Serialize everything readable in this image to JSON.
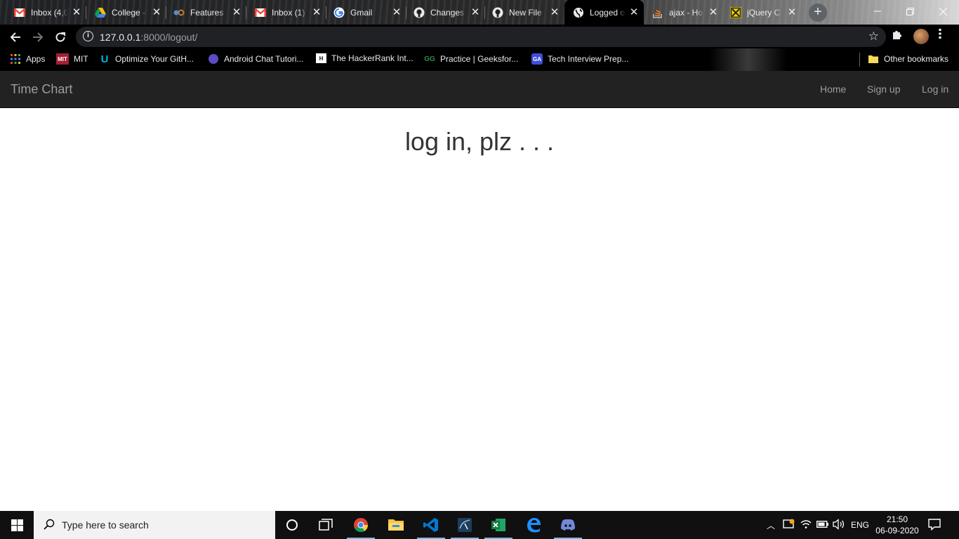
{
  "browser": {
    "tabs": [
      {
        "title": "Inbox (4,0",
        "icon": "gmail-icon",
        "color": "#ea4335"
      },
      {
        "title": "College -",
        "icon": "google-drive-icon",
        "color": "#fbbc04"
      },
      {
        "title": "Features",
        "icon": "feature-site-icon",
        "color": "#4a90d9"
      },
      {
        "title": "Inbox (1)",
        "icon": "gmail-icon",
        "color": "#ea4335"
      },
      {
        "title": "Gmail",
        "icon": "google-icon",
        "color": "#4285f4"
      },
      {
        "title": "Changes",
        "icon": "github-icon",
        "color": "#ffffff"
      },
      {
        "title": "New File",
        "icon": "github-icon",
        "color": "#ffffff"
      },
      {
        "title": "Logged o",
        "icon": "globe-icon",
        "color": "#ffffff",
        "active": true
      },
      {
        "title": "ajax - Ho",
        "icon": "stackoverflow-icon",
        "color": "#f48024"
      },
      {
        "title": "jQuery C",
        "icon": "jquery-icon",
        "color": "#f5d000"
      }
    ],
    "url_host": "127.0.0.1",
    "url_path": ":8000/logout/",
    "bookmarks": [
      {
        "label": "Apps",
        "icon": "apps-grid-icon"
      },
      {
        "label": "MIT",
        "icon": "mit-ocw-icon"
      },
      {
        "label": "Optimize Your GitH...",
        "icon": "udacity-icon"
      },
      {
        "label": "Android Chat Tutori...",
        "icon": "purple-circle-icon"
      },
      {
        "label": "The HackerRank Int...",
        "icon": "hackerrank-icon"
      },
      {
        "label": "Practice | Geeksfor...",
        "icon": "geeksforgeeks-icon"
      },
      {
        "label": "Tech Interview Prep...",
        "icon": "ga-icon"
      }
    ],
    "other_bookmarks": "Other bookmarks"
  },
  "page": {
    "brand": "Time Chart",
    "nav": {
      "home": "Home",
      "signup": "Sign up",
      "login": "Log in"
    },
    "heading": "log in, plz . . ."
  },
  "taskbar": {
    "search_placeholder": "Type here to search",
    "apps": [
      "cortana-icon",
      "task-view-icon",
      "chrome-icon",
      "file-explorer-icon",
      "vscode-icon",
      "mysql-workbench-icon",
      "excel-icon",
      "edge-icon",
      "discord-icon"
    ],
    "language": "ENG",
    "time": "21:50",
    "date": "06-09-2020"
  }
}
